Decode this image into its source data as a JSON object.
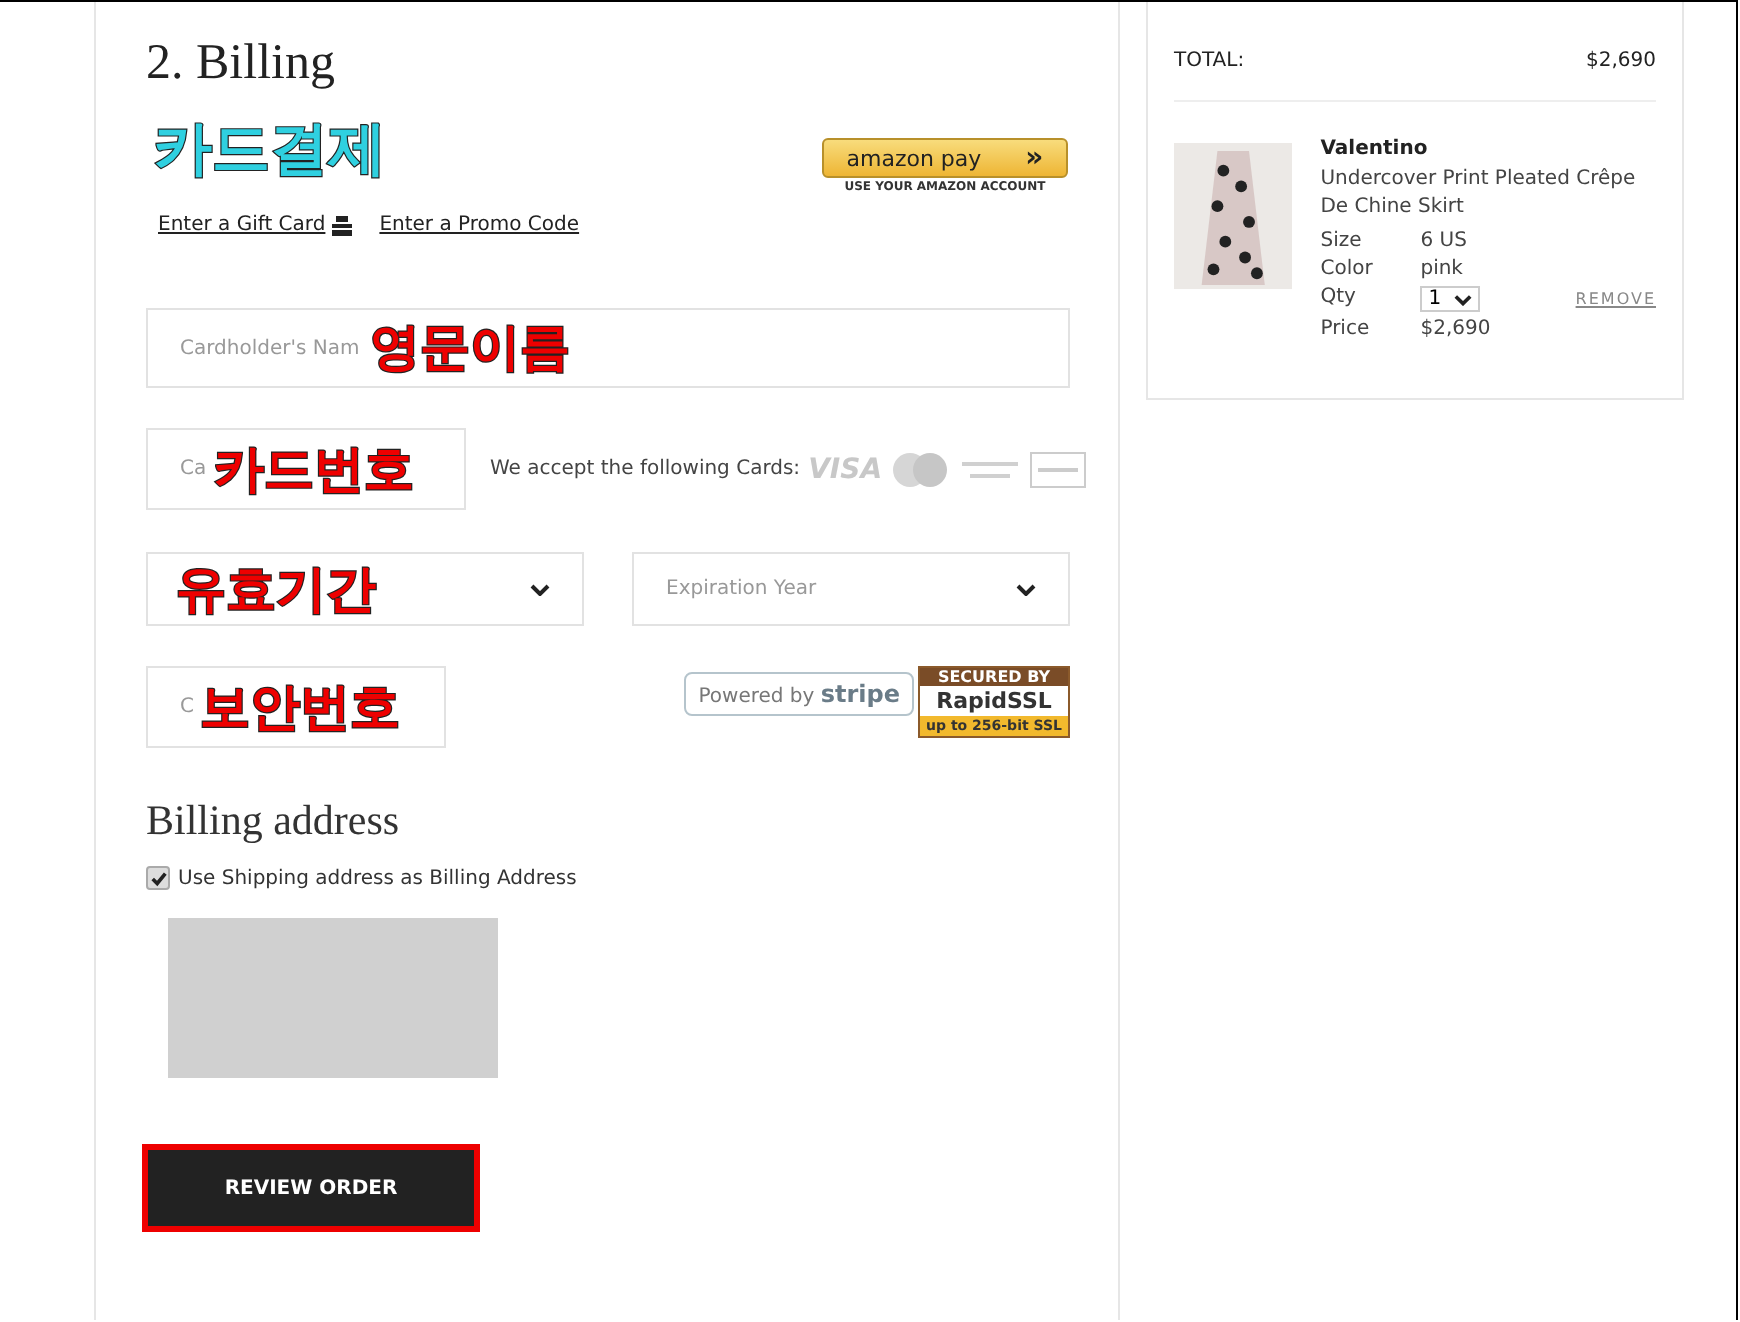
{
  "section_title": "2. Billing",
  "payment_label": "카드결제",
  "amazon_pay": {
    "logo": "amazon pay",
    "arrows": "»",
    "caption": "USE YOUR AMAZON ACCOUNT"
  },
  "links": [
    {
      "label": "Enter a Gift Card",
      "has_icon": true
    },
    {
      "label": "Enter a Promo Code",
      "has_icon": false
    }
  ],
  "name_field": {
    "placeholder": "Cardholder's Nam",
    "annotation": "영문이름"
  },
  "card_number_field": {
    "placeholder": "Ca",
    "annotation": "카드번호"
  },
  "accepted_cards": {
    "label": "We accept the following Cards:",
    "visa": "VISA"
  },
  "expiration_month": {
    "annotation": "유효기간"
  },
  "expiration_year": {
    "placeholder": "Expiration Year"
  },
  "cvc_field": {
    "placeholder": "C",
    "annotation": "보안번호"
  },
  "stripe_badge": {
    "prefix": "Powered by",
    "brand": "stripe"
  },
  "ssl_badge": {
    "top": "SECURED BY",
    "brand": "RapidSSL",
    "bottom": "up to 256-bit SSL"
  },
  "billing_address": {
    "title": "Billing address",
    "checkbox": {
      "label": "Use Shipping address as Billing Address",
      "checked": true
    }
  },
  "review_button": {
    "label": "REVIEW ORDER",
    "outlined": true
  },
  "order_summary": {
    "total_label": "TOTAL:",
    "total": "$2,690",
    "item": {
      "kind": "picture",
      "brand": "Valentino",
      "name": "Undercover Print Pleated Crêpe De Chine Skirt",
      "details": [
        {
          "label": "Size",
          "value": "6 US"
        },
        {
          "label": "Color",
          "value": "pink"
        }
      ],
      "qty_label": "Qty",
      "qty": "1",
      "remove": "REMOVE",
      "price_label": "Price",
      "price": "$2,690"
    }
  }
}
